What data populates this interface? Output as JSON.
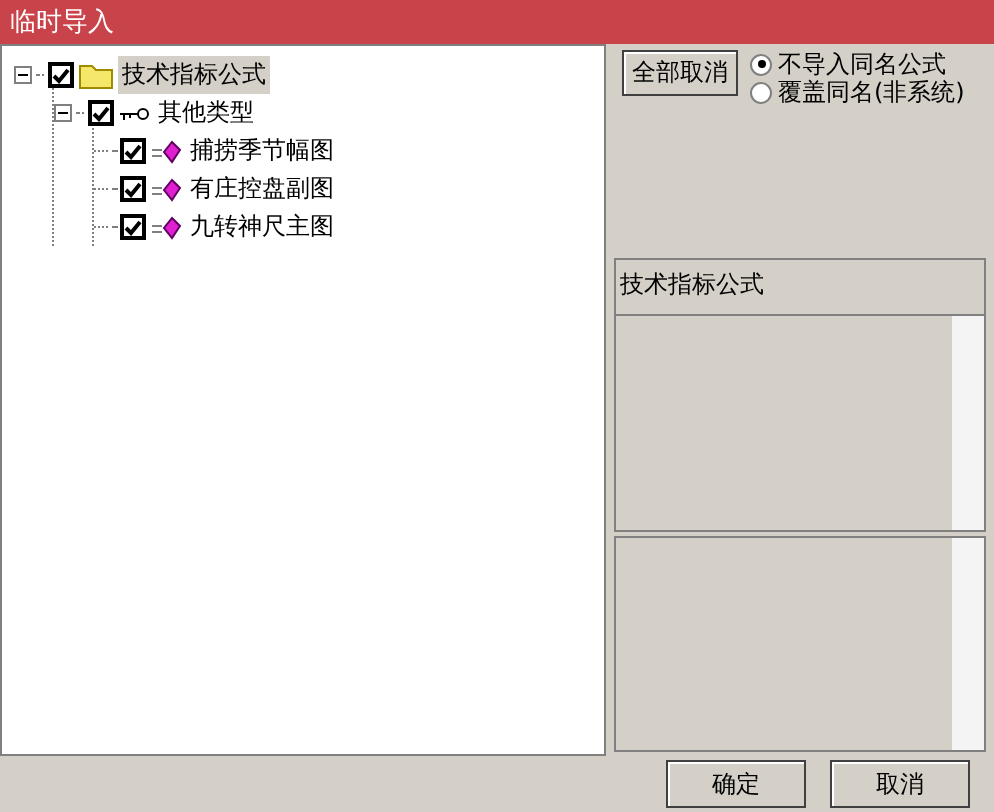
{
  "window": {
    "title": "临时导入"
  },
  "tree": [
    {
      "label": "技术指标公式",
      "kind": "folder",
      "checked": true,
      "expanded": true,
      "selected": true,
      "children": [
        {
          "label": "其他类型",
          "kind": "key",
          "checked": true,
          "expanded": true,
          "selected": false,
          "children": [
            {
              "label": "捕捞季节幅图",
              "kind": "formula",
              "checked": true,
              "selected": false
            },
            {
              "label": "有庄控盘副图",
              "kind": "formula",
              "checked": true,
              "selected": false
            },
            {
              "label": "九转神尺主图",
              "kind": "formula",
              "checked": true,
              "selected": false
            }
          ]
        }
      ]
    }
  ],
  "toolbar": {
    "button": "全部取消"
  },
  "options": [
    {
      "label": "不导入同名公式",
      "selected": true
    },
    {
      "label": "覆盖同名(非系统)",
      "selected": false
    }
  ],
  "detail": {
    "title": "技术指标公式"
  },
  "buttons": [
    "确定",
    "取消"
  ]
}
